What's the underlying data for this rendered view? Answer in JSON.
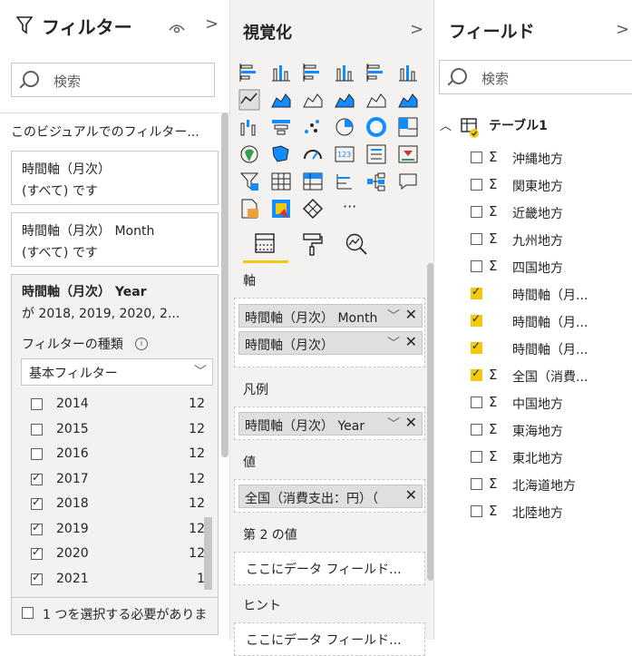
{
  "filters": {
    "title": "フィルター",
    "search_placeholder": "検索",
    "section_label": "このビジュアルでのフィルター...",
    "cards": [
      {
        "name": "時間軸（月次）",
        "value": "(すべて) です"
      },
      {
        "name": "時間軸（月次） Month",
        "value": "(すべて) です"
      }
    ],
    "expanded": {
      "name": "時間軸（月次） Year",
      "summary": "が 2018, 2019, 2020, 2...",
      "type_label": "フィルターの種類",
      "type_value": "基本フィルター",
      "years": [
        {
          "year": "2014",
          "count": "12",
          "checked": false
        },
        {
          "year": "2015",
          "count": "12",
          "checked": false
        },
        {
          "year": "2016",
          "count": "12",
          "checked": false
        },
        {
          "year": "2017",
          "count": "12",
          "checked": true
        },
        {
          "year": "2018",
          "count": "12",
          "checked": true
        },
        {
          "year": "2019",
          "count": "12",
          "checked": true
        },
        {
          "year": "2020",
          "count": "12",
          "checked": true
        },
        {
          "year": "2021",
          "count": "1",
          "checked": true
        }
      ],
      "require_one": "1 つを選択する必要がありま"
    }
  },
  "viz": {
    "title": "視覚化",
    "more": "···",
    "sections": {
      "axis": {
        "label": "軸",
        "items": [
          "時間軸（月次） Month",
          "時間軸（月次）"
        ]
      },
      "legend": {
        "label": "凡例",
        "items": [
          "時間軸（月次） Year"
        ]
      },
      "values": {
        "label": "値",
        "items": [
          "全国（消費支出：円）（"
        ]
      },
      "secondary": {
        "label": "第 2 の値",
        "placeholder": "ここにデータ フィールド..."
      },
      "tooltip": {
        "label": "ヒント",
        "placeholder": "ここにデータ フィールド..."
      }
    }
  },
  "fields": {
    "title": "フィールド",
    "search_placeholder": "検索",
    "table_name": "テーブル1",
    "items": [
      {
        "name": "沖縄地方",
        "sigma": true,
        "checked": false
      },
      {
        "name": "関東地方",
        "sigma": true,
        "checked": false
      },
      {
        "name": "近畿地方",
        "sigma": true,
        "checked": false
      },
      {
        "name": "九州地方",
        "sigma": true,
        "checked": false
      },
      {
        "name": "四国地方",
        "sigma": true,
        "checked": false
      },
      {
        "name": "時間軸（月...",
        "sigma": false,
        "checked": true
      },
      {
        "name": "時間軸（月...",
        "sigma": false,
        "checked": true
      },
      {
        "name": "時間軸（月...",
        "sigma": false,
        "checked": true
      },
      {
        "name": "全国（消費...",
        "sigma": true,
        "checked": true
      },
      {
        "name": "中国地方",
        "sigma": true,
        "checked": false
      },
      {
        "name": "東海地方",
        "sigma": true,
        "checked": false
      },
      {
        "name": "東北地方",
        "sigma": true,
        "checked": false
      },
      {
        "name": "北海道地方",
        "sigma": true,
        "checked": false
      },
      {
        "name": "北陸地方",
        "sigma": true,
        "checked": false
      }
    ]
  },
  "colors": {
    "accent": "#f2c811",
    "viz_blue": "#118dff",
    "border": "#c8c6c4"
  }
}
